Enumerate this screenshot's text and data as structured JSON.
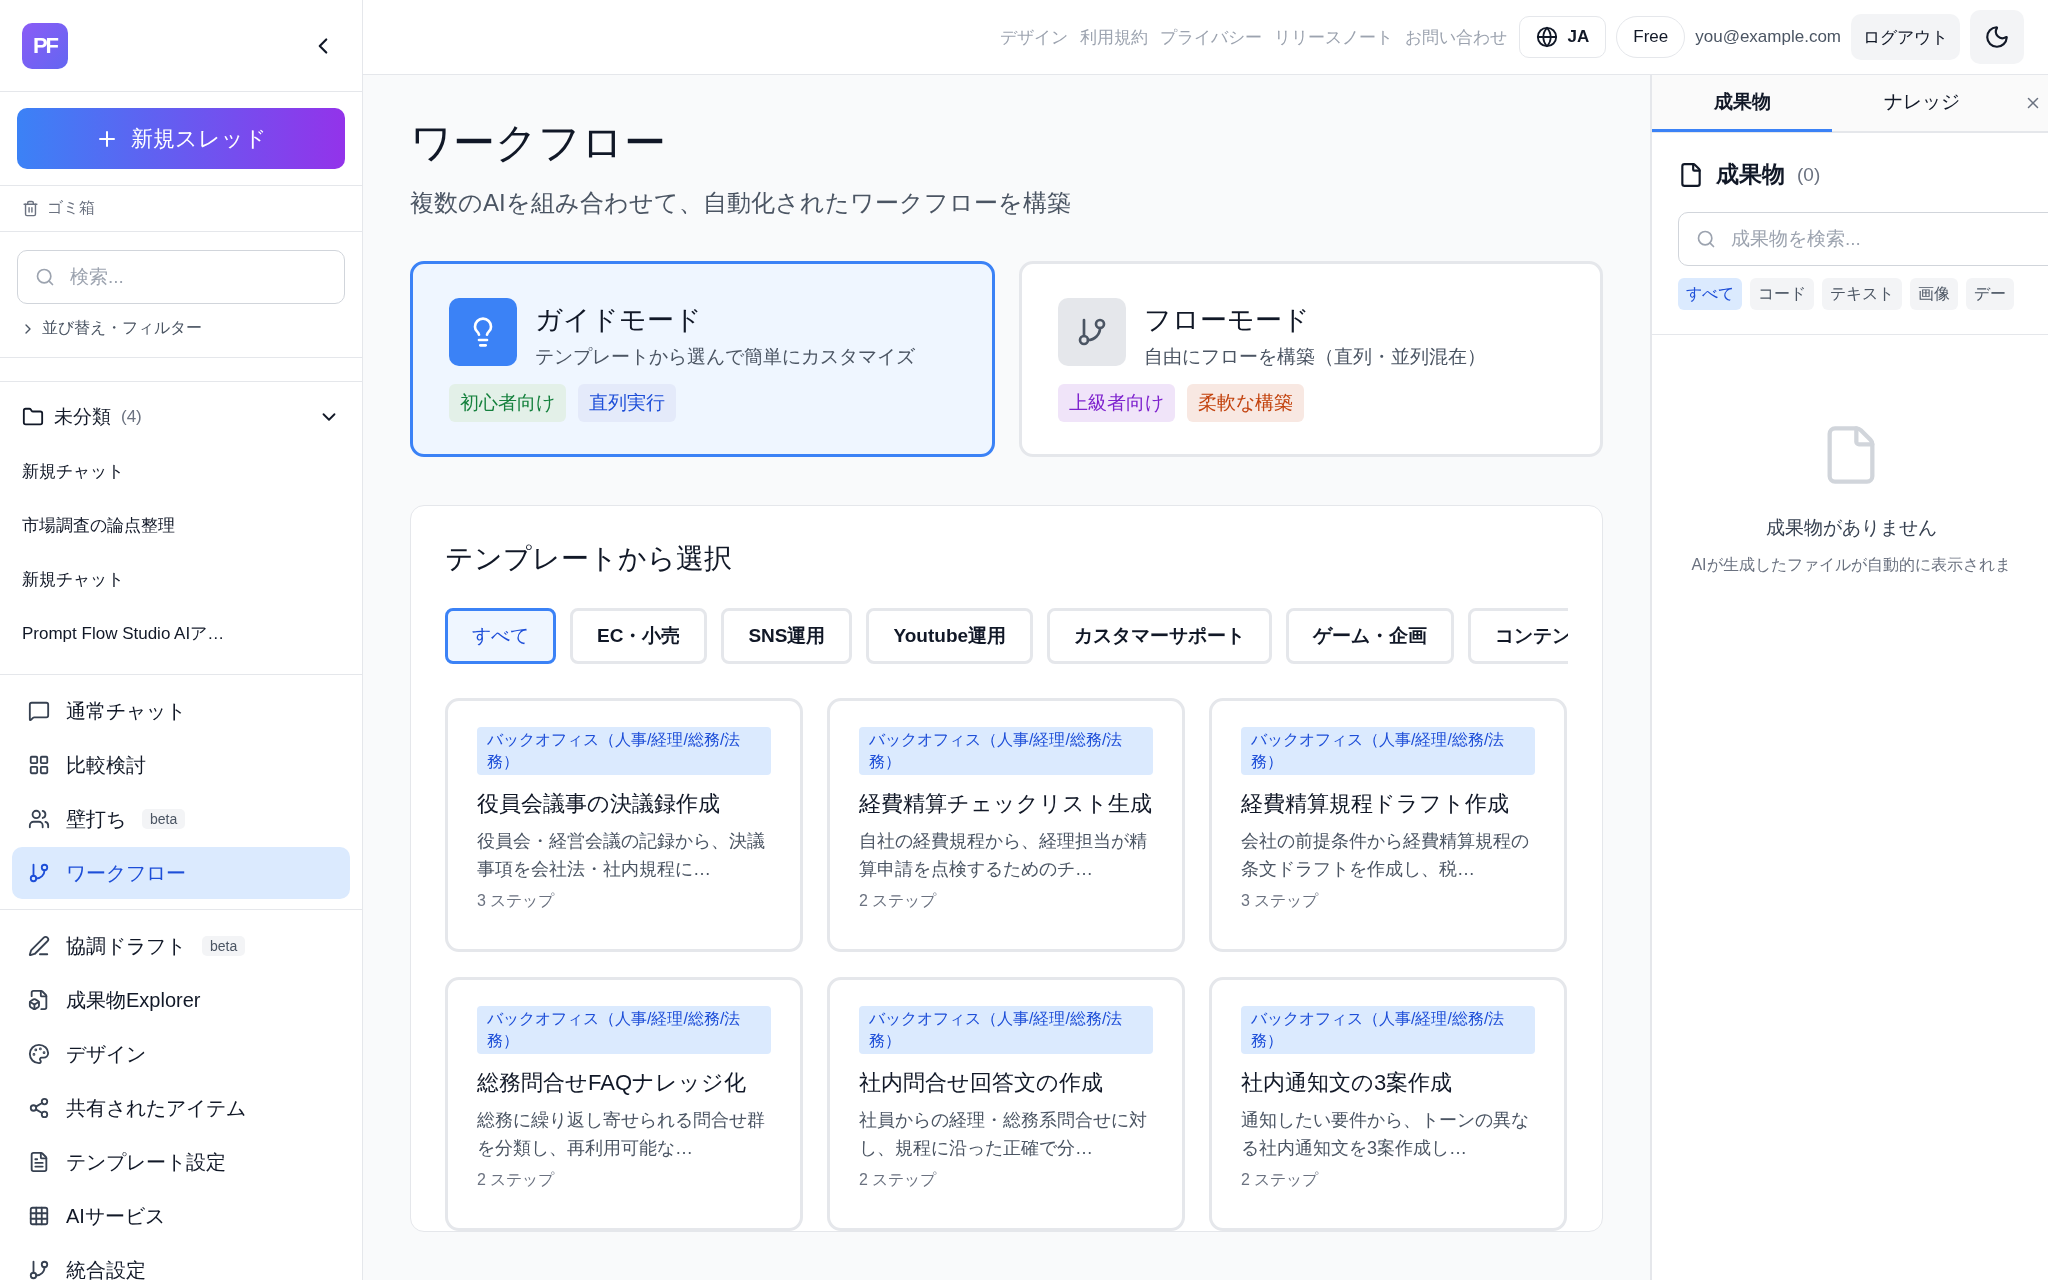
{
  "sidebar": {
    "logo": "PF",
    "new_thread": "新規スレッド",
    "trash": "ゴミ箱",
    "search": {
      "placeholder": "検索..."
    },
    "sort_filter": "並び替え・フィルター",
    "folder": {
      "name": "未分類",
      "count": "(4)",
      "expanded": true,
      "items": [
        "新規チャット",
        "市場調査の論点整理",
        "新規チャット",
        "Prompt Flow Studio AIア…"
      ]
    },
    "nav": [
      {
        "label": "通常チャット",
        "selected": false
      },
      {
        "label": "比較検討",
        "selected": false
      },
      {
        "label": "壁打ち",
        "badge": "beta",
        "selected": false
      },
      {
        "label": "ワークフロー",
        "selected": true
      }
    ],
    "nav2": [
      {
        "label": "協調ドラフト",
        "badge": "beta",
        "selected": false
      },
      {
        "label": "成果物Explorer",
        "selected": false
      },
      {
        "label": "デザイン",
        "selected": false
      },
      {
        "label": "共有されたアイテム",
        "selected": false
      },
      {
        "label": "テンプレート設定",
        "selected": false
      },
      {
        "label": "AIサービス",
        "selected": false
      },
      {
        "label": "統合設定",
        "selected": false
      }
    ]
  },
  "topbar": {
    "links": [
      "デザイン",
      "利用規約",
      "プライバシー",
      "リリースノート",
      "お問い合わせ"
    ],
    "language": "JA",
    "plan": "Free",
    "email": "you@example.com",
    "logout": "ログアウト"
  },
  "page": {
    "title": "ワークフロー",
    "subtitle": "複数のAIを組み合わせて、自動化されたワークフローを構築"
  },
  "modes": [
    {
      "title": "ガイドモード",
      "description": "テンプレートから選んで簡単にカスタマイズ",
      "selected": true,
      "tags": [
        {
          "label": "初心者向け",
          "color": "#15803d"
        },
        {
          "label": "直列実行",
          "color": "#1d4ed8"
        }
      ]
    },
    {
      "title": "フローモード",
      "description": "自由にフローを構築（直列・並列混在）",
      "selected": false,
      "tags": [
        {
          "label": "上級者向け",
          "color": "#7e22ce"
        },
        {
          "label": "柔軟な構築",
          "color": "#c2410c"
        }
      ]
    }
  ],
  "templates": {
    "title": "テンプレートから選択",
    "filters": [
      {
        "label": "すべて",
        "selected": true
      },
      {
        "label": "EC・小売",
        "selected": false
      },
      {
        "label": "SNS運用",
        "selected": false
      },
      {
        "label": "Youtube運用",
        "selected": false
      },
      {
        "label": "カスタマーサポート",
        "selected": false
      },
      {
        "label": "ゲーム・企画",
        "selected": false
      },
      {
        "label": "コンテン",
        "selected": false
      }
    ],
    "cards": [
      {
        "category": "バックオフィス（人事/経理/総務/法務）",
        "title": "役員会議事の決議録作成",
        "description": "役員会・経営会議の記録から、決議事項を会社法・社内規程に…",
        "steps": "3 ステップ"
      },
      {
        "category": "バックオフィス（人事/経理/総務/法務）",
        "title": "経費精算チェックリスト生成",
        "description": "自社の経費規程から、経理担当が精算申請を点検するためのチ…",
        "steps": "2 ステップ"
      },
      {
        "category": "バックオフィス（人事/経理/総務/法務）",
        "title": "経費精算規程ドラフト作成",
        "description": "会社の前提条件から経費精算規程の条文ドラフトを作成し、税…",
        "steps": "3 ステップ"
      },
      {
        "category": "バックオフィス（人事/経理/総務/法務）",
        "title": "総務問合せFAQナレッジ化",
        "description": "総務に繰り返し寄せられる問合せ群を分類し、再利用可能な…",
        "steps": "2 ステップ"
      },
      {
        "category": "バックオフィス（人事/経理/総務/法務）",
        "title": "社内問合せ回答文の作成",
        "description": "社員からの経理・総務系問合せに対し、規程に沿った正確で分…",
        "steps": "2 ステップ"
      },
      {
        "category": "バックオフィス（人事/経理/総務/法務）",
        "title": "社内通知文の3案作成",
        "description": "通知したい要件から、トーンの異なる社内通知文を3案作成し…",
        "steps": "2 ステップ"
      }
    ]
  },
  "right_panel": {
    "tabs": [
      {
        "label": "成果物",
        "selected": true
      },
      {
        "label": "ナレッジ",
        "selected": false
      }
    ],
    "heading": "成果物",
    "count": "(0)",
    "search": {
      "placeholder": "成果物を検索..."
    },
    "filters": [
      {
        "label": "すべて",
        "selected": true
      },
      {
        "label": "コード",
        "selected": false
      },
      {
        "label": "テキスト",
        "selected": false
      },
      {
        "label": "画像",
        "selected": false
      },
      {
        "label": "デー",
        "selected": false
      }
    ],
    "empty_title": "成果物がありません",
    "empty_text": "AIが生成したファイルが自動的に表示されま"
  }
}
